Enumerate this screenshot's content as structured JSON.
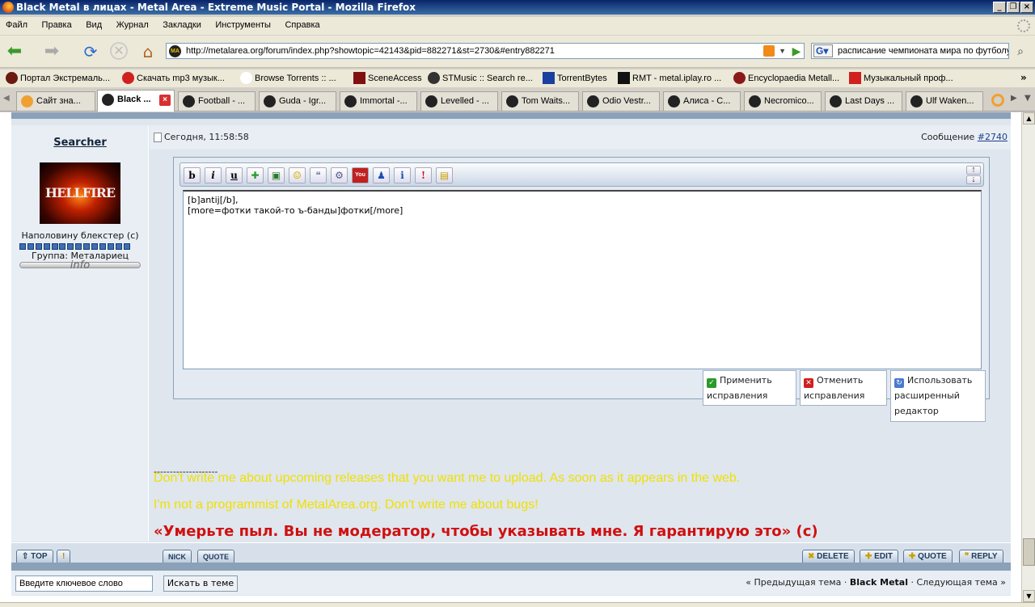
{
  "window": {
    "title": "Black Metal в лицах - Metal Area - Extreme Music Portal - Mozilla Firefox"
  },
  "menu": [
    "Файл",
    "Правка",
    "Вид",
    "Журнал",
    "Закладки",
    "Инструменты",
    "Справка"
  ],
  "nav": {
    "url": "http://metalarea.org/forum/index.php?showtopic=42143&pid=882271&st=2730&#entry882271",
    "search_value": "расписание чемпионата мира по футболу"
  },
  "bookmarks": [
    "Портал Экстремаль...",
    "Скачать mp3 музык...",
    "Browse Torrents :: ...",
    "SceneAccess",
    "STMusic :: Search re...",
    "TorrentBytes",
    "RMT - metal.iplay.ro ...",
    "Encyclopaedia Metall...",
    "Музыкальный проф..."
  ],
  "tabs": [
    "Сайт зна...",
    "Black ...",
    "Football - ...",
    "Guda - Igr...",
    "Immortal -...",
    "Levelled - ...",
    "Tom Waits...",
    "Odio Vestr...",
    "Алиса - C...",
    "Necromico...",
    "Last Days ...",
    "Ulf Waken..."
  ],
  "post": {
    "author": "Searcher",
    "avatar_text": "HELLFIRE",
    "user_status": "Наполовину блекстер (с)",
    "rank_pips": 14,
    "group": "Группа: Металариец",
    "info_label": "info",
    "date": "Сегодня, 11:58:58",
    "message_prefix": "Сообщение",
    "message_number": "#2740",
    "editor_text": "[b]antij[/b],\n[more=фотки такой-то ъ-банды]фотки[/more]",
    "editor_buttons": {
      "apply": "Применить исправления",
      "cancel": "Отменить исправления",
      "advanced": "Использовать расширенный редактор"
    },
    "signature": {
      "separator": "--------------------",
      "line1": "Don't write me about upcoming releases that you want me to upload. As soon as it appears in the web.",
      "line2": "I'm not a programmist of MetalArea.org. Don't write me about bugs!",
      "line3": "«Умерьте пыл. Вы не модератор, чтобы указывать мне. Я гарантирую это» (с)"
    }
  },
  "actions": {
    "top": "TOP",
    "report": "!",
    "nick": "NICK",
    "quick_quote": "QUOTE",
    "delete": "DELETE",
    "edit": "EDIT",
    "quote": "QUOTE",
    "reply": "REPLY"
  },
  "footer": {
    "keyword_placeholder": "Введите ключевое слово",
    "search_button": "Искать в теме",
    "prev": "« Предыдущая тема",
    "sep": "·",
    "forum": "Black Metal",
    "next": "Следующая тема »"
  },
  "colors": {
    "signature_yellow": "#f0e000",
    "signature_red": "#d01010",
    "titlebar": "#0a246a"
  }
}
